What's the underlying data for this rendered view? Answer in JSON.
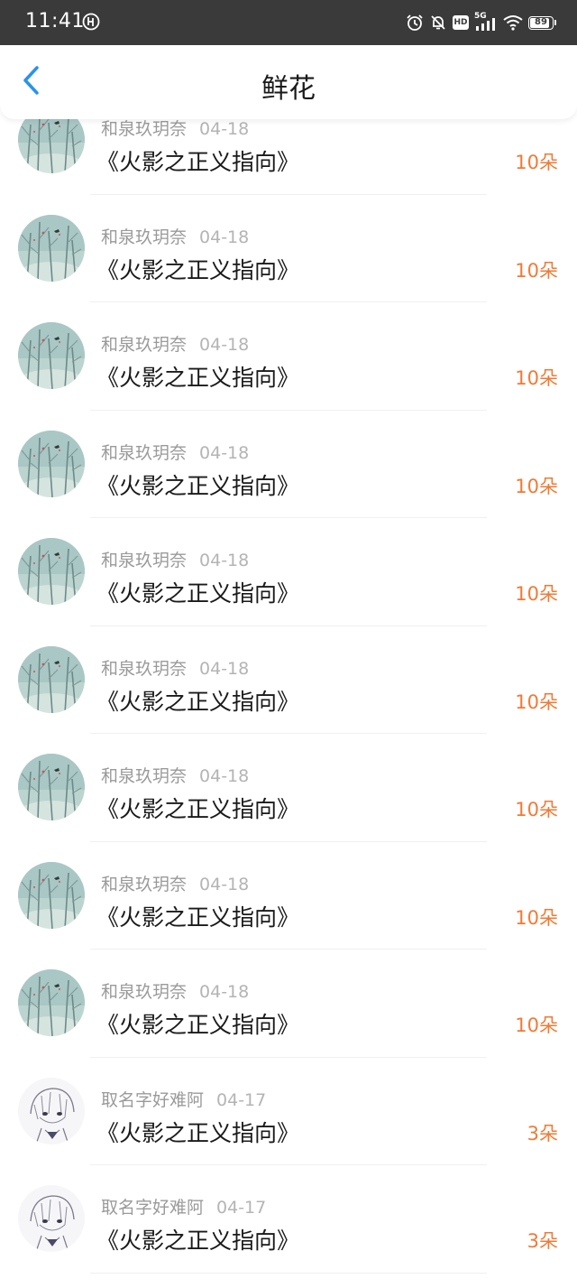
{
  "status_bar": {
    "time": "11:41",
    "network": "5G",
    "hd_label": "HD",
    "battery": "89",
    "battery_level": 0.89,
    "icons": [
      "app-notification-icon",
      "alarm-icon",
      "mute-icon",
      "hd-icon",
      "signal-icon",
      "wifi-icon",
      "battery-icon"
    ]
  },
  "header": {
    "title": "鲜花",
    "back_icon": "chevron-left-icon",
    "accent_color": "#2a93e6"
  },
  "colors": {
    "flower_count": "#f07a36",
    "title_text": "#1a1a1a",
    "meta_text": "#9a9a9a"
  },
  "items": [
    {
      "user": "和泉玖玥奈",
      "date": "04-18",
      "title": "《火影之正义指向》",
      "count": "10朵",
      "avatar": "winter-tree-avatar"
    },
    {
      "user": "和泉玖玥奈",
      "date": "04-18",
      "title": "《火影之正义指向》",
      "count": "10朵",
      "avatar": "winter-tree-avatar"
    },
    {
      "user": "和泉玖玥奈",
      "date": "04-18",
      "title": "《火影之正义指向》",
      "count": "10朵",
      "avatar": "winter-tree-avatar"
    },
    {
      "user": "和泉玖玥奈",
      "date": "04-18",
      "title": "《火影之正义指向》",
      "count": "10朵",
      "avatar": "winter-tree-avatar"
    },
    {
      "user": "和泉玖玥奈",
      "date": "04-18",
      "title": "《火影之正义指向》",
      "count": "10朵",
      "avatar": "winter-tree-avatar"
    },
    {
      "user": "和泉玖玥奈",
      "date": "04-18",
      "title": "《火影之正义指向》",
      "count": "10朵",
      "avatar": "winter-tree-avatar"
    },
    {
      "user": "和泉玖玥奈",
      "date": "04-18",
      "title": "《火影之正义指向》",
      "count": "10朵",
      "avatar": "winter-tree-avatar"
    },
    {
      "user": "和泉玖玥奈",
      "date": "04-18",
      "title": "《火影之正义指向》",
      "count": "10朵",
      "avatar": "winter-tree-avatar"
    },
    {
      "user": "和泉玖玥奈",
      "date": "04-18",
      "title": "《火影之正义指向》",
      "count": "10朵",
      "avatar": "winter-tree-avatar"
    },
    {
      "user": "取名字好难阿",
      "date": "04-17",
      "title": "《火影之正义指向》",
      "count": "3朵",
      "avatar": "anime-sketch-avatar"
    },
    {
      "user": "取名字好难阿",
      "date": "04-17",
      "title": "《火影之正义指向》",
      "count": "3朵",
      "avatar": "anime-sketch-avatar"
    }
  ]
}
